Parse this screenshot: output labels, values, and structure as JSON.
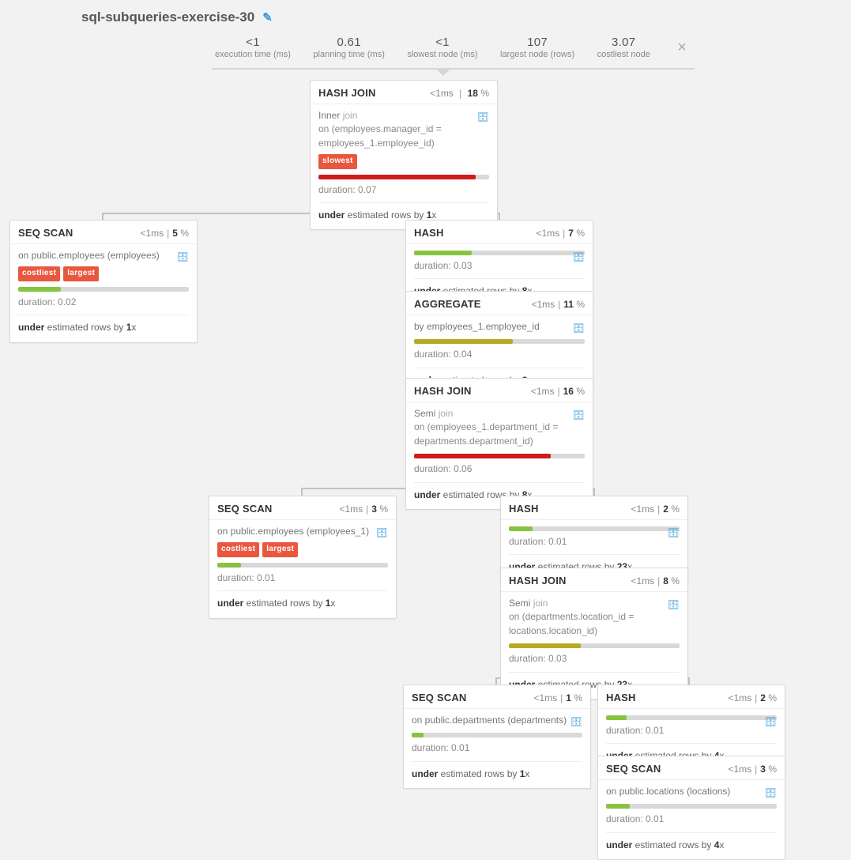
{
  "title": "sql-subqueries-exercise-30",
  "stats": [
    {
      "value": "<1",
      "label": "execution time (ms)"
    },
    {
      "value": "0.61",
      "label": "planning time (ms)"
    },
    {
      "value": "<1",
      "label": "slowest node (ms)"
    },
    {
      "value": "107",
      "label": "largest node (rows)"
    },
    {
      "value": "3.07",
      "label": "costliest node"
    }
  ],
  "nodes": {
    "hashjoin1": {
      "title": "HASH JOIN",
      "ms": "<1",
      "pct": "18",
      "pre": "Inner ",
      "jw": "join",
      "cond": "on (employees.manager_id = employees_1.employee_id)",
      "tags": [
        "slowest"
      ],
      "bar_color": "red",
      "bar_pct": 92,
      "duration": "0.07",
      "est_direction": "under",
      "est_by": "1"
    },
    "seqscan1": {
      "title": "SEQ SCAN",
      "ms": "<1",
      "pct": "5",
      "sub": "on public.employees (employees)",
      "tags": [
        "costliest",
        "largest"
      ],
      "bar_color": "green",
      "bar_pct": 25,
      "duration": "0.02",
      "est_direction": "under",
      "est_by": "1"
    },
    "hash1": {
      "title": "HASH",
      "ms": "<1",
      "pct": "7",
      "bar_color": "green",
      "bar_pct": 34,
      "duration": "0.03",
      "est_direction": "under",
      "est_by": "8"
    },
    "aggregate": {
      "title": "AGGREGATE",
      "ms": "<1",
      "pct": "11",
      "sub": "by employees_1.employee_id",
      "bar_color": "olive",
      "bar_pct": 58,
      "duration": "0.04",
      "est_direction": "under",
      "est_by": "8"
    },
    "hashjoin2": {
      "title": "HASH JOIN",
      "ms": "<1",
      "pct": "16",
      "pre": "Semi ",
      "jw": "join",
      "cond": "on (employees_1.department_id = departments.department_id)",
      "bar_color": "red",
      "bar_pct": 80,
      "duration": "0.06",
      "est_direction": "under",
      "est_by": "8"
    },
    "seqscan2": {
      "title": "SEQ SCAN",
      "ms": "<1",
      "pct": "3",
      "sub": "on public.employees (employees_1)",
      "tags": [
        "costliest",
        "largest"
      ],
      "bar_color": "green",
      "bar_pct": 14,
      "duration": "0.01",
      "est_direction": "under",
      "est_by": "1"
    },
    "hash2": {
      "title": "HASH",
      "ms": "<1",
      "pct": "2",
      "bar_color": "green",
      "bar_pct": 14,
      "duration": "0.01",
      "est_direction": "under",
      "est_by": "23"
    },
    "hashjoin3": {
      "title": "HASH JOIN",
      "ms": "<1",
      "pct": "8",
      "pre": "Semi ",
      "jw": "join",
      "cond": "on (departments.location_id = locations.location_id)",
      "bar_color": "olive",
      "bar_pct": 42,
      "duration": "0.03",
      "est_direction": "under",
      "est_by": "23"
    },
    "seqscan3": {
      "title": "SEQ SCAN",
      "ms": "<1",
      "pct": "1",
      "sub": "on public.departments (departments)",
      "bar_color": "green",
      "bar_pct": 7,
      "duration": "0.01",
      "est_direction": "under",
      "est_by": "1"
    },
    "hash3": {
      "title": "HASH",
      "ms": "<1",
      "pct": "2",
      "bar_color": "green",
      "bar_pct": 12,
      "duration": "0.01",
      "est_direction": "under",
      "est_by": "4"
    },
    "seqscan4": {
      "title": "SEQ SCAN",
      "ms": "<1",
      "pct": "3",
      "sub": "on public.locations (locations)",
      "bar_color": "green",
      "bar_pct": 14,
      "duration": "0.01",
      "est_direction": "under",
      "est_by": "4"
    }
  },
  "labels": {
    "ms_unit": "ms",
    "pct_unit": "%",
    "duration": "duration: ",
    "est_suffix_1": " estimated rows by ",
    "x": "x"
  }
}
